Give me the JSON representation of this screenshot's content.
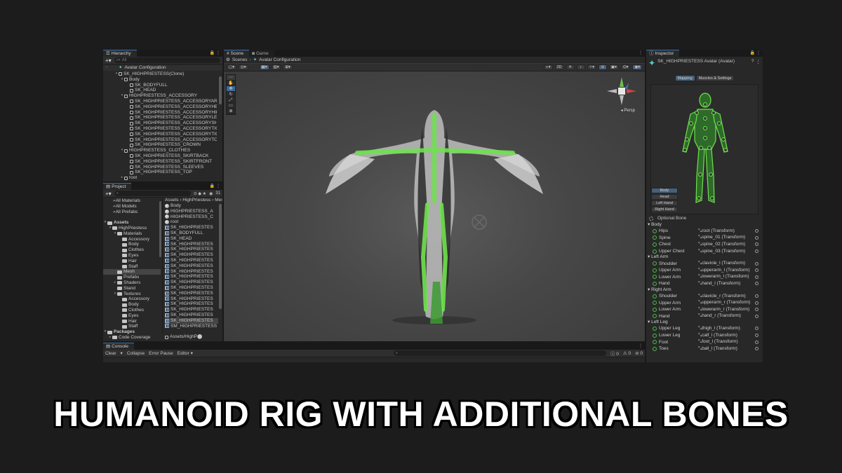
{
  "hierarchy": {
    "tab": "Hierarchy",
    "search_placeholder": "All",
    "scene_title": "Avatar Configuration",
    "items": [
      {
        "label": "SK_HIGHPRIESTESS(Clone)",
        "indent": 1,
        "tri": "▾"
      },
      {
        "label": "Body",
        "indent": 2,
        "tri": "▾"
      },
      {
        "label": "SK_BODYFULL",
        "indent": 3,
        "tri": ""
      },
      {
        "label": "SK_HEAD",
        "indent": 3,
        "tri": ""
      },
      {
        "label": "HIGHPRIESTESS_ACCESSORY",
        "indent": 2,
        "tri": "▾"
      },
      {
        "label": "SK_HIGHPRIESTESS_ACCESSORYARM",
        "indent": 3,
        "tri": ""
      },
      {
        "label": "SK_HIGHPRIESTESS_ACCESSORYHEAD",
        "indent": 3,
        "tri": ""
      },
      {
        "label": "SK_HIGHPRIESTESS_ACCESSORYHIPS",
        "indent": 3,
        "tri": ""
      },
      {
        "label": "SK_HIGHPRIESTESS_ACCESSORYLEG",
        "indent": 3,
        "tri": ""
      },
      {
        "label": "SK_HIGHPRIESTESS_ACCESSORYSHOU",
        "indent": 3,
        "tri": ""
      },
      {
        "label": "SK_HIGHPRIESTESS_ACCESSORYTIGH",
        "indent": 3,
        "tri": ""
      },
      {
        "label": "SK_HIGHPRIESTESS_ACCESSORYTIGH",
        "indent": 3,
        "tri": ""
      },
      {
        "label": "SK_HIGHPRIESTESS_ACCESSORYTORS",
        "indent": 3,
        "tri": ""
      },
      {
        "label": "SK_HIGHPRIESTESS_CROWN",
        "indent": 3,
        "tri": ""
      },
      {
        "label": "HIGHPRIESTESS_CLOTHES",
        "indent": 2,
        "tri": "▾"
      },
      {
        "label": "SK_HIGHPRIESTESS_SKIRTBACK",
        "indent": 3,
        "tri": ""
      },
      {
        "label": "SK_HIGHPRIESTESS_SKIRTFRONT",
        "indent": 3,
        "tri": ""
      },
      {
        "label": "SK_HIGHPRIESTESS_SLEEVES",
        "indent": 3,
        "tri": ""
      },
      {
        "label": "SK_HIGHPRIESTESS_TOP",
        "indent": 3,
        "tri": ""
      },
      {
        "label": "root",
        "indent": 2,
        "tri": "▸"
      }
    ]
  },
  "project": {
    "tab": "Project",
    "count": "31",
    "favorites": [
      "All Materials",
      "All Models",
      "All Prefabs"
    ],
    "tree": [
      {
        "label": "Assets",
        "indent": 0,
        "bold": true,
        "tri": "▾"
      },
      {
        "label": "HighPriestess",
        "indent": 1,
        "tri": "▾"
      },
      {
        "label": "Materials",
        "indent": 2,
        "tri": "▾"
      },
      {
        "label": "Accessory",
        "indent": 3,
        "tri": ""
      },
      {
        "label": "Body",
        "indent": 3,
        "tri": ""
      },
      {
        "label": "Clothes",
        "indent": 3,
        "tri": ""
      },
      {
        "label": "Eyes",
        "indent": 3,
        "tri": ""
      },
      {
        "label": "Hair",
        "indent": 3,
        "tri": ""
      },
      {
        "label": "Staff",
        "indent": 3,
        "tri": ""
      },
      {
        "label": "Mesh",
        "indent": 2,
        "tri": "",
        "hl": true
      },
      {
        "label": "Prefabs",
        "indent": 2,
        "tri": ""
      },
      {
        "label": "Shaders",
        "indent": 2,
        "tri": "▸"
      },
      {
        "label": "Stand",
        "indent": 2,
        "tri": ""
      },
      {
        "label": "Textures",
        "indent": 2,
        "tri": "▾"
      },
      {
        "label": "Accessory",
        "indent": 3,
        "tri": ""
      },
      {
        "label": "Body",
        "indent": 3,
        "tri": ""
      },
      {
        "label": "Clothes",
        "indent": 3,
        "tri": ""
      },
      {
        "label": "Eyes",
        "indent": 3,
        "tri": ""
      },
      {
        "label": "Hair",
        "indent": 3,
        "tri": ""
      },
      {
        "label": "Staff",
        "indent": 3,
        "tri": ""
      },
      {
        "label": "Packages",
        "indent": 0,
        "bold": true,
        "tri": "▾"
      },
      {
        "label": "Code Coverage",
        "indent": 1,
        "tri": "▸"
      }
    ],
    "breadcrumb": [
      "Assets",
      "HighPriestess",
      "Mesh"
    ],
    "assets": [
      {
        "label": "Body",
        "icon": "material"
      },
      {
        "label": "HIGHPRIESTESS_A",
        "icon": "material"
      },
      {
        "label": "HIGHPRIESTESS_C",
        "icon": "material"
      },
      {
        "label": "root",
        "icon": "material"
      },
      {
        "label": "SK_HIGHPRIESTES",
        "icon": "mesh"
      },
      {
        "label": "SK_BODYFULL",
        "icon": "mesh"
      },
      {
        "label": "SK_HEAD",
        "icon": "mesh"
      },
      {
        "label": "SK_HIGHPRIESTES",
        "icon": "mesh"
      },
      {
        "label": "SK_HIGHPRIESTES",
        "icon": "mesh"
      },
      {
        "label": "SK_HIGHPRIESTES",
        "icon": "mesh"
      },
      {
        "label": "SK_HIGHPRIESTES",
        "icon": "mesh"
      },
      {
        "label": "SK_HIGHPRIESTES",
        "icon": "mesh"
      },
      {
        "label": "SK_HIGHPRIESTES",
        "icon": "mesh"
      },
      {
        "label": "SK_HIGHPRIESTES",
        "icon": "mesh"
      },
      {
        "label": "SK_HIGHPRIESTES",
        "icon": "mesh"
      },
      {
        "label": "SK_HIGHPRIESTES",
        "icon": "mesh"
      },
      {
        "label": "SK_HIGHPRIESTES",
        "icon": "mesh"
      },
      {
        "label": "SK_HIGHPRIESTES",
        "icon": "mesh"
      },
      {
        "label": "SK_HIGHPRIESTES",
        "icon": "mesh"
      },
      {
        "label": "SK_HIGHPRIESTES",
        "icon": "mesh"
      },
      {
        "label": "SK_HIGHPRIESTES",
        "icon": "mesh"
      },
      {
        "label": "SK_HIGHPRIESTES",
        "icon": "mesh",
        "sel": true
      },
      {
        "label": "SM_HIGHPRIESTESS",
        "icon": "mesh"
      }
    ],
    "footer_path": "Assets/HighP"
  },
  "scene": {
    "tabs": [
      "Scene",
      "Game"
    ],
    "breadcrumb_root": "Scenes",
    "breadcrumb_current": "Avatar Configuration",
    "btn_2d": "2D",
    "persp_label": "Persp"
  },
  "console": {
    "tab": "Console",
    "clear": "Clear",
    "collapse": "Collapse",
    "error_pause": "Error Pause",
    "editor": "Editor",
    "count_msgs": "0",
    "count_warn": "0",
    "count_err": "0"
  },
  "inspector": {
    "tab": "Inspector",
    "title": "SK_HIGHPRIESTESS Avatar (Avatar)",
    "tab_mapping": "Mapping",
    "tab_muscles": "Muscles & Settings",
    "body_buttons": [
      "Body",
      "Head",
      "Left Hand",
      "Right Hand"
    ],
    "optional_bone": "Optional Bone",
    "groups": [
      {
        "name": "Body",
        "rows": [
          {
            "label": "Hips",
            "value": "root (Transform)"
          },
          {
            "label": "Spine",
            "value": "spine_01 (Transform)"
          },
          {
            "label": "Chest",
            "value": "spine_02 (Transform)"
          },
          {
            "label": "Upper Chest",
            "value": "spine_03 (Transform)"
          }
        ]
      },
      {
        "name": "Left Arm",
        "rows": [
          {
            "label": "Shoulder",
            "value": "clavicle_l (Transform)"
          },
          {
            "label": "Upper Arm",
            "value": "upperarm_l (Transform)"
          },
          {
            "label": "Lower Arm",
            "value": "lowerarm_l (Transform)"
          },
          {
            "label": "Hand",
            "value": "hand_l (Transform)"
          }
        ]
      },
      {
        "name": "Right Arm",
        "rows": [
          {
            "label": "Shoulder",
            "value": "clavicle_r (Transform)"
          },
          {
            "label": "Upper Arm",
            "value": "upperarm_r (Transform)"
          },
          {
            "label": "Lower Arm",
            "value": "lowerarm_r (Transform)"
          },
          {
            "label": "Hand",
            "value": "hand_r (Transform)"
          }
        ]
      },
      {
        "name": "Left Leg",
        "rows": [
          {
            "label": "Upper Leg",
            "value": "thigh_l (Transform)"
          },
          {
            "label": "Lower Leg",
            "value": "calf_l (Transform)"
          },
          {
            "label": "Foot",
            "value": "foot_l (Transform)"
          },
          {
            "label": "Toes",
            "value": "ball_l (Transform)"
          }
        ]
      }
    ]
  },
  "caption": "HUMANOID RIG WITH ADDITIONAL BONES",
  "colors": {
    "accent": "#3a72b0",
    "bone_green": "#6fe24d",
    "selection": "#2c5d87"
  }
}
